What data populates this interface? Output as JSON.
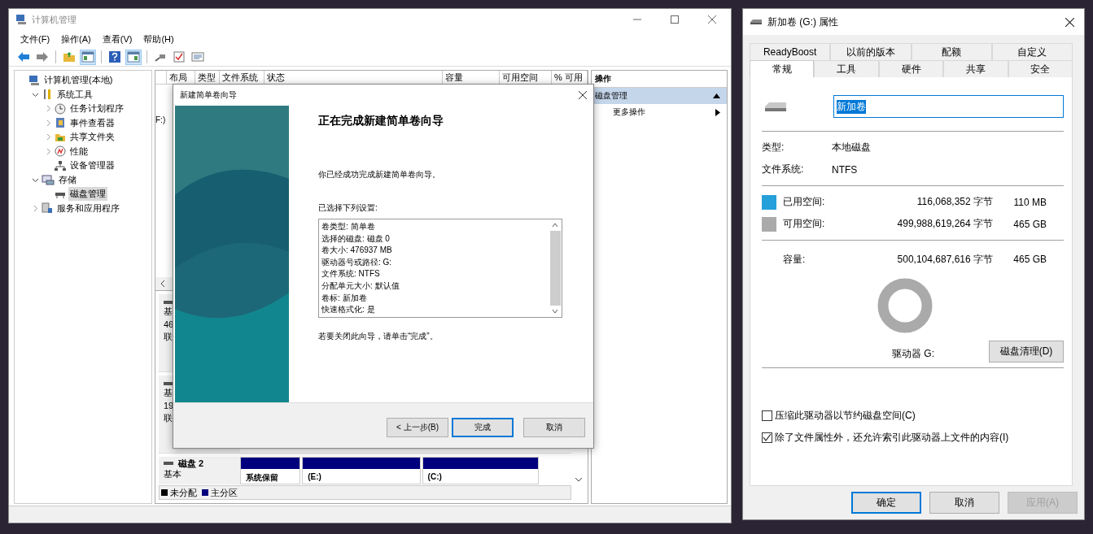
{
  "main_window": {
    "title": "计算机管理",
    "menu": [
      "文件(F)",
      "操作(A)",
      "查看(V)",
      "帮助(H)"
    ],
    "toolbar_groups": [
      [
        {
          "kind": "back",
          "on": false
        },
        {
          "kind": "forward",
          "on": false
        }
      ],
      [
        {
          "kind": "folder",
          "on": false
        },
        {
          "kind": "console",
          "on": true
        }
      ],
      [
        {
          "kind": "help",
          "on": false
        },
        {
          "kind": "pane",
          "on": true
        }
      ],
      [
        {
          "kind": "rescan",
          "on": false
        },
        {
          "kind": "check",
          "on": false
        },
        {
          "kind": "list",
          "on": false
        }
      ]
    ],
    "tree": [
      {
        "label": "计算机管理(本地)",
        "kind": "computer",
        "selected": false,
        "children": [
          {
            "label": "系统工具",
            "kind": "tools",
            "expanded": true,
            "selected": false,
            "children": [
              {
                "label": "任务计划程序",
                "kind": "clock",
                "expanded": false,
                "selected": false
              },
              {
                "label": "事件查看器",
                "kind": "log",
                "expanded": false,
                "selected": false
              },
              {
                "label": "共享文件夹",
                "kind": "share",
                "expanded": false,
                "selected": false
              },
              {
                "label": "性能",
                "kind": "perf",
                "expanded": false,
                "selected": false
              },
              {
                "label": "设备管理器",
                "kind": "device",
                "selected": false
              }
            ]
          },
          {
            "label": "存储",
            "kind": "storage",
            "expanded": true,
            "selected": false,
            "children": [
              {
                "label": "磁盘管理",
                "kind": "disk",
                "selected": true
              }
            ]
          },
          {
            "label": "服务和应用程序",
            "kind": "services",
            "expanded": false,
            "selected": false
          }
        ]
      }
    ],
    "table": {
      "columns": [
        "布局",
        "类型",
        "文件系统",
        "状态",
        "容量",
        "可用空间",
        "% 可用"
      ],
      "cut_cells": [
        "F:)"
      ]
    },
    "disks": [
      {
        "lines": [
          "基",
          "46",
          "联"
        ]
      },
      {
        "lines": [
          "基",
          "19",
          "联"
        ]
      },
      {
        "name": "磁盘 2",
        "type": "基本",
        "partitions": [
          "系统保留",
          "(E:)",
          "(C:)"
        ]
      }
    ],
    "legend": [
      {
        "label": "未分配",
        "color": "#000000"
      },
      {
        "label": "主分区",
        "color": "#00007f"
      }
    ],
    "actions": {
      "header": "操作",
      "items": [
        {
          "label": "磁盘管理",
          "kind": "section",
          "selected": true
        },
        {
          "label": "更多操作",
          "kind": "submenu",
          "selected": false
        }
      ]
    }
  },
  "wizard": {
    "title": "新建简单卷向导",
    "heading": "正在完成新建简单卷向导",
    "intro": "你已经成功完成新建简单卷向导。",
    "settings_label": "已选择下列设置:",
    "settings": [
      "卷类型: 简单卷",
      "选择的磁盘: 磁盘 0",
      "卷大小: 476937 MB",
      "驱动器号或路径: G:",
      "文件系统: NTFS",
      "分配单元大小: 默认值",
      "卷标: 新加卷",
      "快速格式化: 是"
    ],
    "closing_note": "若要关闭此向导，请单击“完成”。",
    "buttons": [
      {
        "label": "< 上一步(B)",
        "default": false
      },
      {
        "label": "完成",
        "default": true
      },
      {
        "label": "取消",
        "default": false
      }
    ]
  },
  "properties": {
    "title": "新加卷 (G:) 属性",
    "tab_rows": [
      [
        {
          "label": "ReadyBoost",
          "selected": false
        },
        {
          "label": "以前的版本",
          "selected": false
        },
        {
          "label": "配额",
          "selected": false
        },
        {
          "label": "自定义",
          "selected": false
        }
      ],
      [
        {
          "label": "常规",
          "selected": true
        },
        {
          "label": "工具",
          "selected": false
        },
        {
          "label": "硬件",
          "selected": false
        },
        {
          "label": "共享",
          "selected": false
        },
        {
          "label": "安全",
          "selected": false
        }
      ]
    ],
    "volume_name": "新加卷",
    "type_label": "类型:",
    "type": "本地磁盘",
    "fs_label": "文件系统:",
    "fs": "NTFS",
    "space": [
      {
        "label": "已用空间:",
        "bytes": "116,068,352 字节",
        "size": "110 MB",
        "color": "#26a0da"
      },
      {
        "label": "可用空间:",
        "bytes": "499,988,619,264 字节",
        "size": "465 GB",
        "color": "#aaaaaa"
      }
    ],
    "capacity": {
      "label": "容量:",
      "bytes": "500,104,687,616 字节",
      "size": "465 GB"
    },
    "drive_label": "驱动器 G:",
    "cleanup_button": "磁盘清理(D)",
    "options": [
      {
        "label": "压缩此驱动器以节约磁盘空间(C)",
        "checked": false
      },
      {
        "label": "除了文件属性外，还允许索引此驱动器上文件的内容(I)",
        "checked": true
      }
    ],
    "buttons": [
      {
        "label": "确定",
        "default": true,
        "disabled": false
      },
      {
        "label": "取消",
        "default": false,
        "disabled": false
      },
      {
        "label": "应用(A)",
        "default": false,
        "disabled": true
      }
    ]
  }
}
